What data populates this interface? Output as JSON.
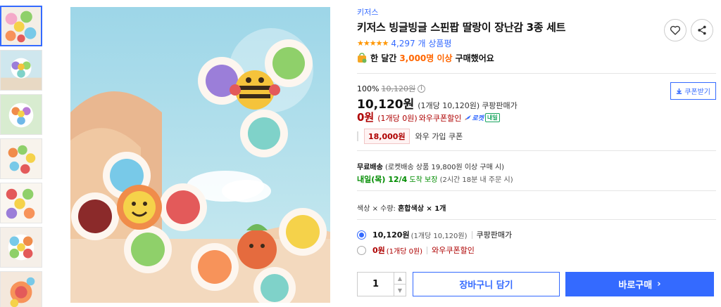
{
  "thumbnails": [
    {
      "name": "thumb-1"
    },
    {
      "name": "thumb-2"
    },
    {
      "name": "thumb-3"
    },
    {
      "name": "thumb-4"
    },
    {
      "name": "thumb-5"
    },
    {
      "name": "thumb-6"
    },
    {
      "name": "thumb-7"
    }
  ],
  "product": {
    "brand": "키저스",
    "title": "키저스 빙글빙글 스핀팝 딸랑이 장난감 3종 세트",
    "stars": "★★★★★",
    "review_count": "4,297 개 상품평",
    "bought_prefix": "한 달간",
    "bought_count": "3,000명 이상",
    "bought_suffix": "구매했어요"
  },
  "price": {
    "discount_rate": "100%",
    "original_price": "10,120원",
    "info_icon": "i",
    "coupon_button": "쿠폰받기",
    "sale_price": "10,120원",
    "sale_per_unit": "(1개당 10,120원)",
    "sale_seller": "쿠팡판매가",
    "coupon_price": "0원",
    "coupon_per_unit": "(1개당 0원)",
    "coupon_label": "와우쿠폰할인",
    "rocket_label": "로켓",
    "rocket_tomorrow": "내일",
    "wow_price": "18,000원",
    "wow_label": "와우 가입 쿠폰"
  },
  "shipping": {
    "free_label": "무료배송",
    "free_detail": "(로켓배송 상품 19,800원 이상 구매 시)",
    "arrival_date": "내일(목) 12/4",
    "arrival_label": "도착 보장",
    "arrival_detail": "(2시간 18분 내 주문 시)"
  },
  "option": {
    "label": "색상 × 수량:",
    "value": "혼합색상 × 1개"
  },
  "price_options": [
    {
      "price": "10,120원",
      "per": "(1개당 10,120원)",
      "label": "쿠팡판매가",
      "selected": true
    },
    {
      "price": "0원",
      "per": "(1개당 0원)",
      "label": "와우쿠폰할인",
      "selected": false
    }
  ],
  "purchase": {
    "quantity": "1",
    "up_glyph": "▲",
    "down_glyph": "▼",
    "cart_button": "장바구니 담기",
    "buy_button": "바로구매",
    "buy_arrow": "›"
  },
  "colors": {
    "accent": "#346aff",
    "red": "#ae0000",
    "green": "#008c00",
    "orange": "#ff6600",
    "star": "#ff9600"
  },
  "icons": {
    "heart": "heart-icon",
    "share": "share-icon",
    "bag": "shopping-bag-icon",
    "download": "download-icon",
    "chevron": "chevron-right-icon"
  }
}
